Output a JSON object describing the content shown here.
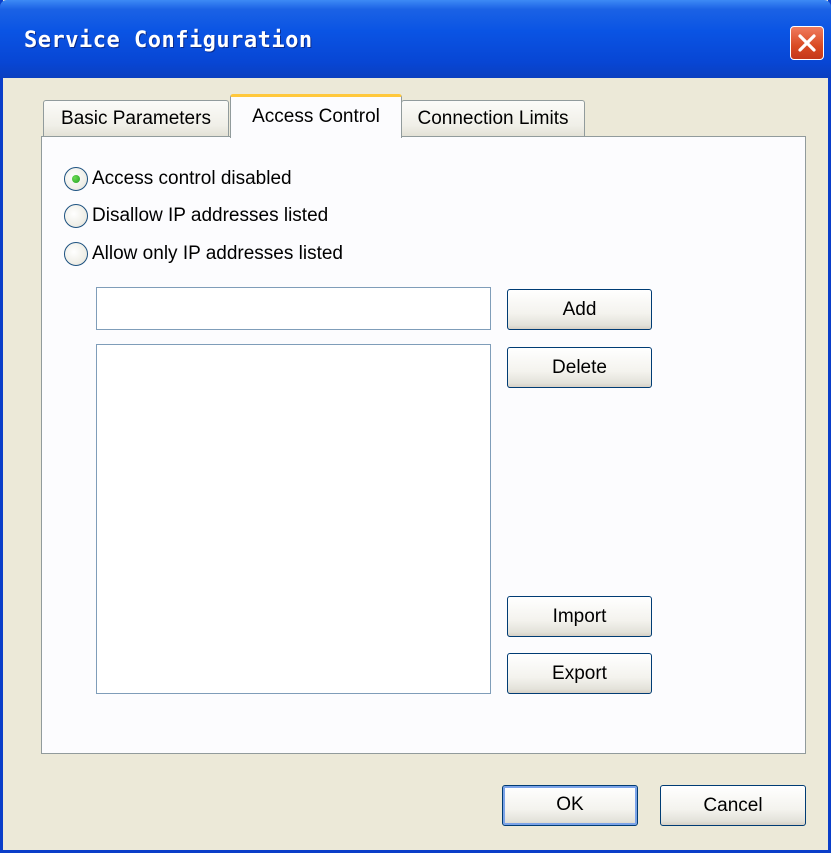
{
  "window": {
    "title": "Service Configuration"
  },
  "tabs": [
    {
      "label": "Basic Parameters",
      "selected": false
    },
    {
      "label": "Access Control",
      "selected": true
    },
    {
      "label": "Connection Limits",
      "selected": false
    }
  ],
  "access_control": {
    "options": [
      {
        "label": "Access control disabled",
        "selected": true
      },
      {
        "label": "Disallow IP addresses listed",
        "selected": false
      },
      {
        "label": "Allow only IP addresses listed",
        "selected": false
      }
    ],
    "ip_input": {
      "value": "",
      "placeholder": ""
    },
    "ip_list": [],
    "buttons": {
      "add": "Add",
      "delete": "Delete",
      "import": "Import",
      "export": "Export"
    }
  },
  "footer": {
    "ok": "OK",
    "cancel": "Cancel"
  },
  "colors": {
    "titlebar": "#0a54e4",
    "dialog_bg": "#ece9d8",
    "selected_tab_accent": "#ffc83c",
    "close_button": "#d94a22"
  },
  "icons": {
    "close": "close-icon"
  }
}
